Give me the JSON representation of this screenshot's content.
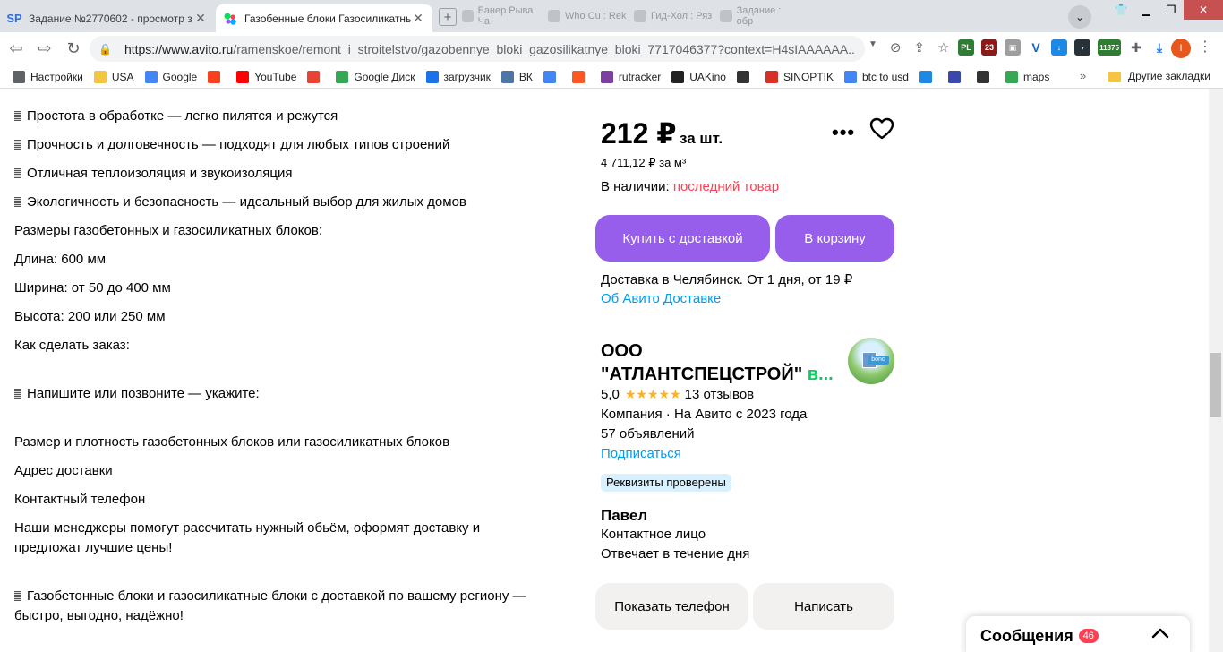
{
  "browser": {
    "tabs": [
      {
        "favicon": "SP",
        "title": "Задание №2770602 - просмотр з",
        "active": false
      },
      {
        "favicon": "avito-icon",
        "title": "Газобенные блоки Газосиликатны",
        "active": true
      }
    ],
    "ghost_tabs": [
      "Банер Рыва Ча",
      "Who Cu : Rek",
      "Гид-Хол : Ряз",
      "Задание : обр"
    ],
    "url_main": "https://www.avito.ru",
    "url_rest": "/ramenskoe/remont_i_stroitelstvo/gazobennye_bloki_gazosilikatnye_bloki_7717046377?context=H4sIAAAAAA...",
    "profile_initial": "I",
    "ext_badges": {
      "pl": "PL",
      "num23": "23",
      "num11875": "11875"
    }
  },
  "bookmarks": {
    "items": [
      {
        "icon": "gear-icon",
        "label": "Настройки",
        "color": "#5f6368"
      },
      {
        "icon": "folder-icon",
        "label": "USA",
        "color": "#f4c542"
      },
      {
        "icon": "google-icon",
        "label": "Google",
        "color": "#4285f4"
      },
      {
        "icon": "yandex-icon",
        "label": "",
        "color": "#fc3f1d"
      },
      {
        "icon": "youtube-icon",
        "label": "YouTube",
        "color": "#ff0000"
      },
      {
        "icon": "gmail-icon",
        "label": "",
        "color": "#ea4335"
      },
      {
        "icon": "drive-icon",
        "label": "Google Диск",
        "color": "#34a853"
      },
      {
        "icon": "infinity-icon",
        "label": "загрузчик",
        "color": "#1a73e8"
      },
      {
        "icon": "vk-icon",
        "label": "ВК",
        "color": "#4c75a3"
      },
      {
        "icon": "translate-icon",
        "label": "",
        "color": "#4285f4"
      },
      {
        "icon": "f-icon",
        "label": "",
        "color": "#ff5722"
      },
      {
        "icon": "rutracker-icon",
        "label": "rutracker",
        "color": "#7b3fa0"
      },
      {
        "icon": "uakino-icon",
        "label": "UAKino",
        "color": "#222222"
      },
      {
        "icon": "pawn-icon",
        "label": "",
        "color": "#333333"
      },
      {
        "icon": "thermometer-icon",
        "label": "SINOPTIK",
        "color": "#d93025"
      },
      {
        "icon": "google-icon",
        "label": "btc to usd",
        "color": "#4285f4"
      },
      {
        "icon": "p-icon",
        "label": "",
        "color": "#1e88e5"
      },
      {
        "icon": "arrow-icon",
        "label": "",
        "color": "#3949ab"
      },
      {
        "icon": "bc-icon",
        "label": "",
        "color": "#333333"
      },
      {
        "icon": "maps-icon",
        "label": "maps",
        "color": "#34a853"
      }
    ],
    "more": "»",
    "other": "Другие закладки"
  },
  "description": {
    "lines": [
      {
        "text": "Простота в обработке — легко пилятся и режутся",
        "bullet": true
      },
      {
        "text": "Прочность и долговечность — подходят для любых типов строений",
        "bullet": true
      },
      {
        "text": "Отличная теплоизоляция и звукоизоляция",
        "bullet": true
      },
      {
        "text": "Экологичность и безопасность — идеальный выбор для жилых домов",
        "bullet": true
      },
      {
        "text": "Размеры газобетонных и газосиликатных блоков:",
        "bullet": false
      },
      {
        "text": "Длина: 600 мм",
        "bullet": false
      },
      {
        "text": "Ширина: от 50 до 400 мм",
        "bullet": false
      },
      {
        "text": "Высота: 200 или 250 мм",
        "bullet": false
      },
      {
        "text": "Как сделать заказ:",
        "bullet": false
      },
      {
        "text": "Напишите или позвоните — укажите:",
        "bullet": true
      },
      {
        "text": "Размер и плотность газобетонных блоков или газосиликатных блоков",
        "bullet": false
      },
      {
        "text": "Адрес доставки",
        "bullet": false
      },
      {
        "text": "Контактный телефон",
        "bullet": false
      },
      {
        "text": "Наши менеджеры помогут рассчитать нужный обьём, оформят доставку и",
        "bullet": false
      },
      {
        "text": "предложат лучшие цены!",
        "bullet": false
      },
      {
        "text": "Газобетонные блоки и газосиликатные блоки с доставкой по вашему региону —",
        "bullet": true
      },
      {
        "text": "быстро, выгодно, надёжно!",
        "bullet": false
      }
    ]
  },
  "listing": {
    "price": "212 ₽",
    "price_unit": "за шт.",
    "price_per_m3": "4 711,12 ₽ за м³",
    "stock_label": "В наличии:",
    "stock_value": "последний товар",
    "buy_button": "Купить с доставкой",
    "cart_button": "В корзину",
    "delivery_text": "Доставка в Челябинск. От 1 дня, от 19 ₽",
    "delivery_link": "Об Авито Доставке"
  },
  "seller": {
    "name_line1": "ООО",
    "name_line2": "\"АТЛАНТСПЕЦСТРОЙ\"",
    "name_more": " в...",
    "logo_text": "bono",
    "rating": "5,0",
    "stars": "★★★★★",
    "reviews": "13 отзывов",
    "company_info": "Компания · На Авито с 2023 года",
    "ads_count": "57 объявлений",
    "subscribe": "Подписаться",
    "verified_badge": "Реквизиты проверены"
  },
  "contact": {
    "name": "Павел",
    "role": "Контактное лицо",
    "response": "Отвечает в течение дня",
    "show_phone_button": "Показать телефон",
    "write_button": "Написать"
  },
  "messages": {
    "label": "Сообщения",
    "count": "46"
  },
  "colors": {
    "purple": "#965eeb",
    "link": "#009cf0",
    "red": "#ff4053",
    "green": "#02d15c"
  }
}
